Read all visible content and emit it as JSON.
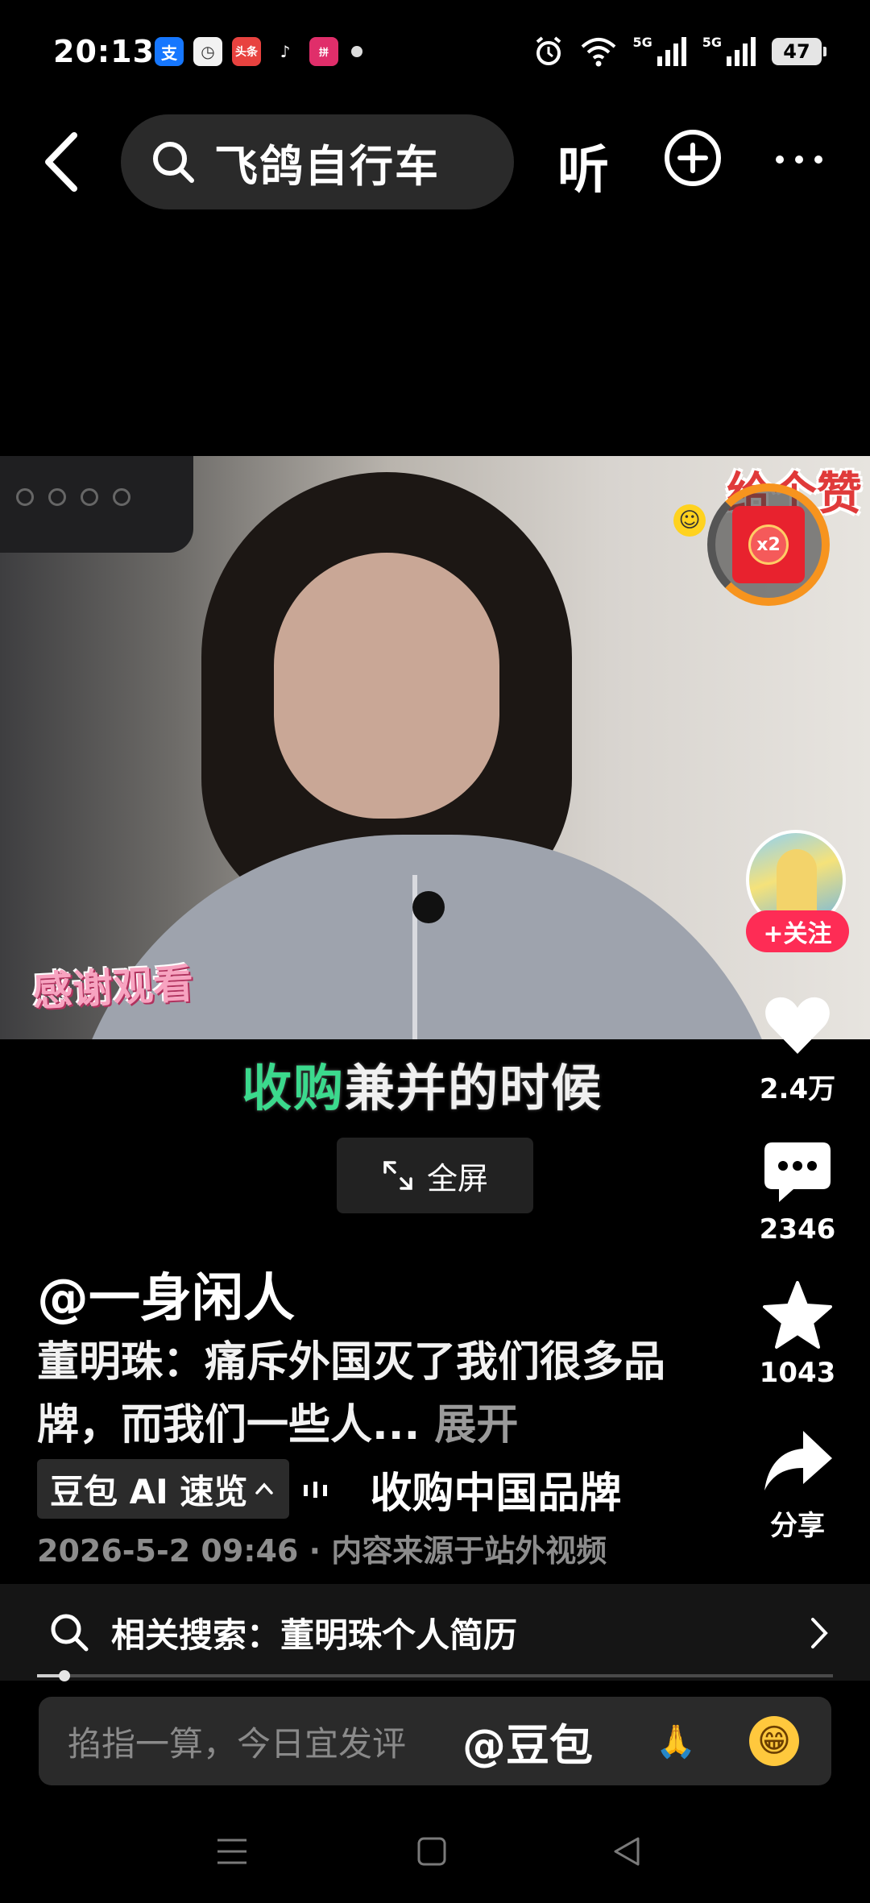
{
  "status_bar": {
    "time": "20:13",
    "notifications": [
      {
        "icon": "alipay-icon",
        "glyph": "支"
      },
      {
        "icon": "clock-icon",
        "glyph": "◷"
      },
      {
        "icon": "toutiao-icon",
        "glyph": "头条"
      },
      {
        "icon": "tiktok-icon",
        "glyph": "♪"
      },
      {
        "icon": "pinduoduo-icon",
        "glyph": "拼"
      }
    ],
    "signal_1": "5G",
    "signal_2": "5G",
    "battery": "47"
  },
  "top_bar": {
    "search_text": "飞鸽自行车",
    "listen_label": "听"
  },
  "video": {
    "overlay_text": "感谢观看",
    "sticker_text": "给个赞",
    "red_packet_badge": "x2"
  },
  "subtitle": {
    "highlight": "收购",
    "rest": "兼并的时候",
    "highlight_color": "#3bd98d"
  },
  "fullscreen_label": "全屏",
  "rail": {
    "follow_label": "+关注",
    "likes": "2.4万",
    "comments": "2346",
    "favorites": "1043",
    "share_label": "分享"
  },
  "post": {
    "author": "@一身闲人",
    "description": "董明珠：痛斥外国灭了我们很多品牌，而我们一些人...",
    "expand_label": "展开",
    "ai_tag": "豆包 AI 速览",
    "ai_summary": "收购中国品牌",
    "meta": "2026-5-2 09:46 · 内容来源于站外视频"
  },
  "related": {
    "text": "相关搜索：董明珠个人简历"
  },
  "progress": {
    "fraction": 0.034
  },
  "comment_bar": {
    "placeholder": "掐指一算，今日宜发评",
    "mention": "@豆包",
    "emoji_1": "🙏",
    "emoji_2": "😁"
  },
  "colors": {
    "accent_red": "#fe2c55",
    "background": "#000000"
  }
}
